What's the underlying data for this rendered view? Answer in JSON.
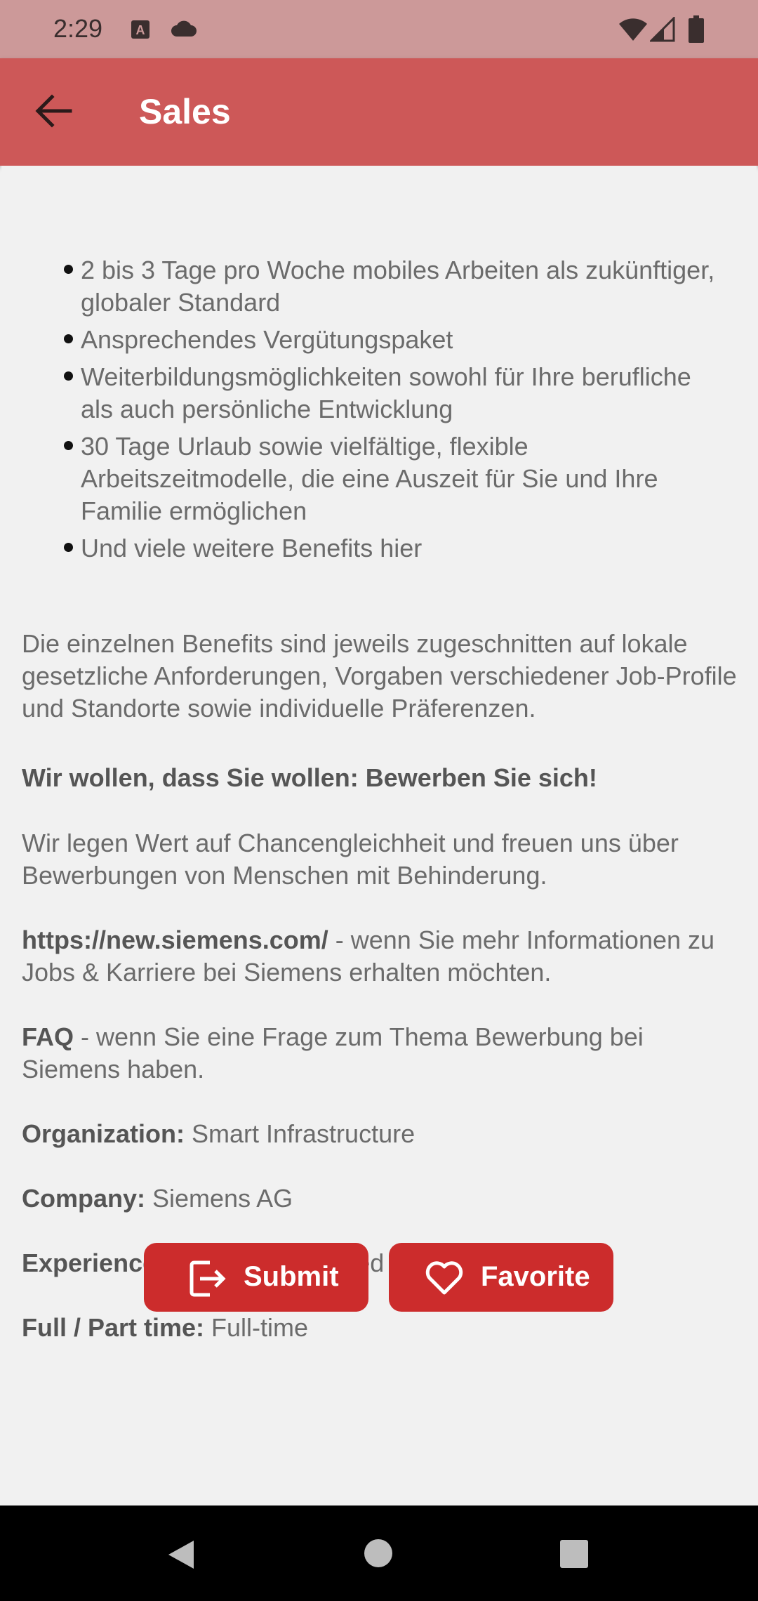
{
  "status_bar": {
    "time": "2:29",
    "icons": [
      "a11y-badge-icon",
      "cloud-icon",
      "wifi-icon",
      "signal-icon",
      "battery-icon"
    ]
  },
  "app_bar": {
    "back_icon": "arrow-left-icon",
    "title": "Sales"
  },
  "benefits": [
    "2 bis 3 Tage pro Woche mobiles Arbeiten als zukünftiger, globaler Standard",
    "Ansprechendes Vergütungspaket",
    "Weiterbildungsmöglichkeiten sowohl für Ihre berufliche als auch persönliche Entwicklung",
    "30 Tage Urlaub sowie vielfältige, flexible Arbeitszeitmodelle, die eine Auszeit für Sie und Ihre Familie ermöglichen",
    "Und viele weitere Benefits hier"
  ],
  "paragraphs": {
    "benefits_note": "Die einzelnen Benefits sind jeweils zugeschnitten auf lokale gesetzliche Anforderungen, Vorgaben verschiedener Job-Profile und Standorte sowie individuelle Präferenzen.",
    "call_to_action": "Wir wollen, dass Sie wollen: Bewerben Sie sich!",
    "equality": "Wir legen Wert auf Chancengleichheit und freuen uns über Bewerbungen von Menschen mit Behinderung.",
    "link_url": "https://new.siemens.com/",
    "link_text": " - wenn Sie mehr Informationen zu Jobs & Karriere bei Siemens erhalten möchten.",
    "faq_label": "FAQ",
    "faq_text": " - wenn Sie eine Frage zum Thema Bewerbung bei Siemens haben."
  },
  "details": {
    "organization_label": "Organization:",
    "organization_value": " Smart Infrastructure",
    "company_label": "Company:",
    "company_value": " Siemens AG",
    "experience_label": "Experience Level:",
    "experience_value": " Experienced Professional",
    "time_label": "Full / Part time:",
    "time_value": " Full-time"
  },
  "actions": {
    "submit_label": "Submit",
    "submit_icon": "exit-to-app-icon",
    "favorite_label": "Favorite",
    "favorite_icon": "heart-outline-icon"
  },
  "navigation": {
    "back_icon": "nav-back-triangle-icon",
    "home_icon": "nav-home-circle-icon",
    "recents_icon": "nav-recents-square-icon"
  },
  "colors": {
    "status_bar": "#cc9999",
    "app_bar": "#cd5858",
    "button": "#cc2c2c",
    "background": "#f1f1f1",
    "text": "#6b6b6b"
  }
}
